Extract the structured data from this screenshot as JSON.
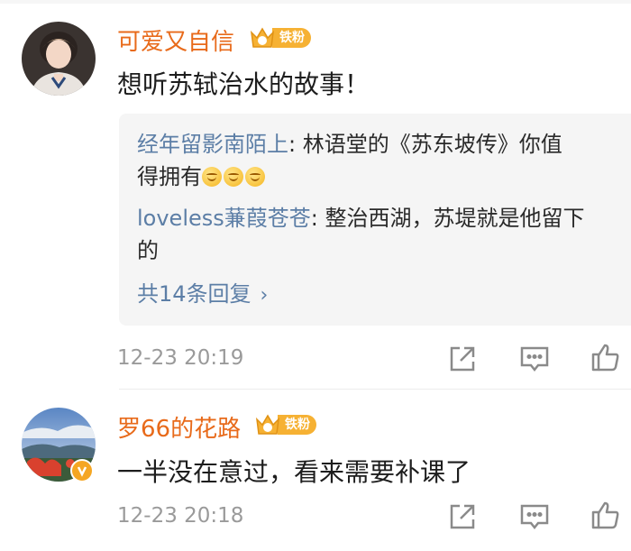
{
  "comments": [
    {
      "username": "可爱又自信",
      "badge": {
        "level": "2",
        "label": "铁粉"
      },
      "text": "想听苏轼治水的故事！",
      "replies": [
        {
          "author": "经年留影南陌上",
          "text_line1": ": 林语堂的《苏东坡传》你值",
          "text_line2": "得拥有",
          "emoji_count": 3
        },
        {
          "author": "loveless蒹葭苍苍",
          "text_line1": ": 整治西湖，苏堤就是他留下",
          "text_line2": "的"
        }
      ],
      "more_replies": "共14条回复",
      "timestamp": "12-23 20:19"
    },
    {
      "username": "罗66的花路",
      "badge": {
        "level": "4",
        "label": "铁粉"
      },
      "text": "一半没在意过，看来需要补课了",
      "timestamp": "12-23 20:18",
      "verified": true
    }
  ],
  "colors": {
    "username": "#e86a1a",
    "reply_author": "#5c7ea6",
    "timestamp": "#9a9a9a",
    "badge": "#f6b133"
  },
  "icons": [
    "share-icon",
    "comment-icon",
    "like-icon"
  ]
}
